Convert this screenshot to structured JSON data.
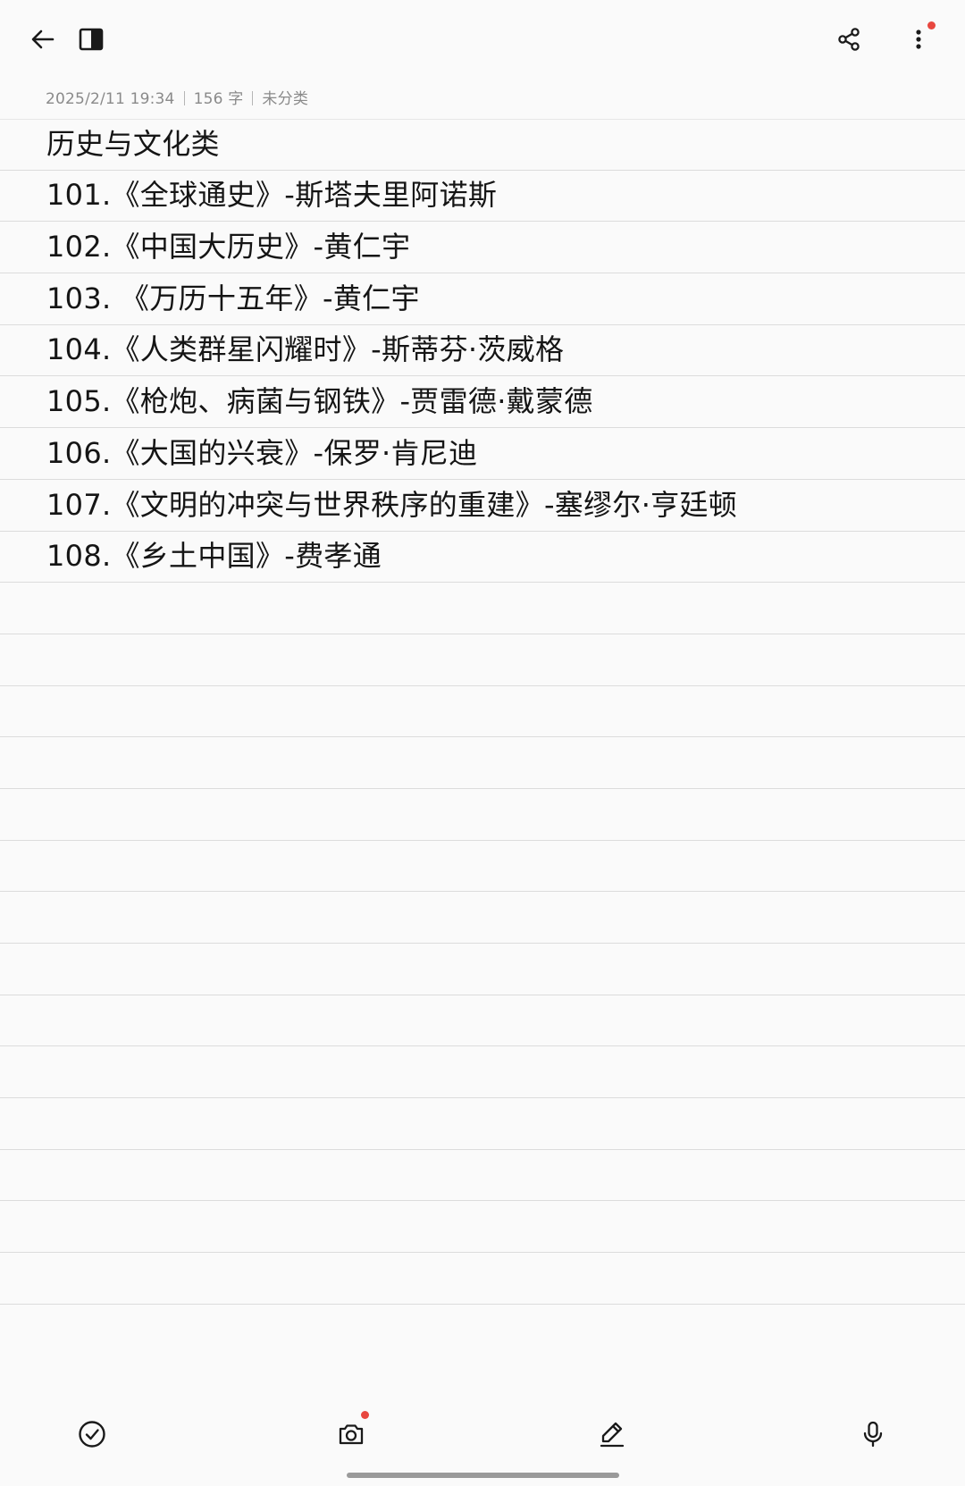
{
  "topbar": {
    "icons": [
      "back-arrow-icon",
      "split-view-icon",
      "share-icon",
      "more-vertical-icon"
    ]
  },
  "meta": {
    "date": "2025/2/11 19:34",
    "word_count": "156 字",
    "category": "未分类"
  },
  "note": {
    "heading": "历史与文化类",
    "items": [
      "101.《全球通史》-斯塔夫里阿诺斯",
      "102.《中国大历史》-黄仁宇",
      "103. 《万历十五年》-黄仁宇",
      "104.《人类群星闪耀时》-斯蒂芬·茨威格",
      "105.《枪炮、病菌与钢铁》-贾雷德·戴蒙德",
      "106.《大国的兴衰》-保罗·肯尼迪",
      "107.《文明的冲突与世界秩序的重建》-塞缪尔·亨廷顿",
      "108.《乡土中国》-费孝通"
    ]
  },
  "toolbar": {
    "icons": [
      "checklist-icon",
      "camera-icon",
      "pen-icon",
      "microphone-icon"
    ]
  },
  "colors": {
    "background": "#fafafa",
    "text": "#151515",
    "meta_text": "#8a8a8a",
    "rule_line": "#dcdcdc",
    "notification_dot": "#e8473f"
  }
}
